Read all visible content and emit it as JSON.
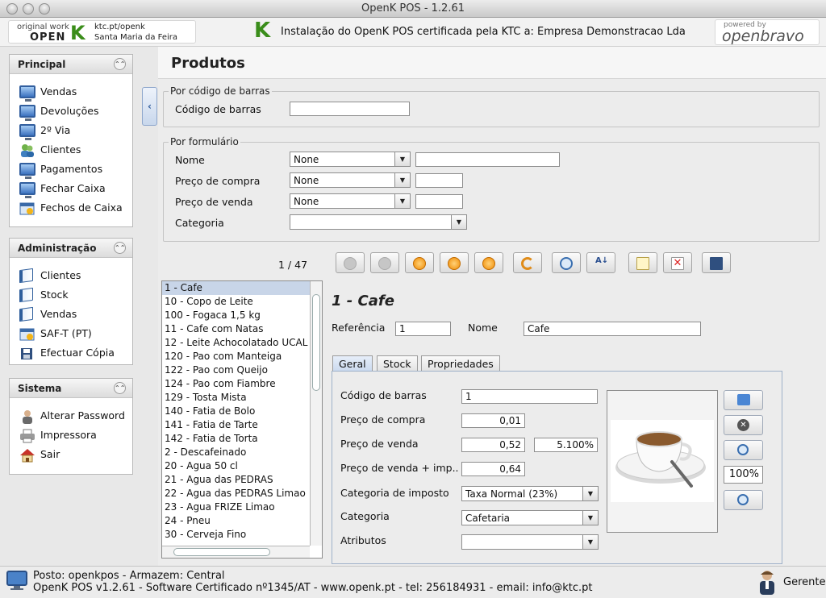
{
  "window": {
    "title": "OpenK POS - 1.2.61"
  },
  "header": {
    "logo_original_work": "original work",
    "logo_brand": "OPEN",
    "logo_k": "K",
    "logo_url": "ktc.pt/openk",
    "logo_city": "Santa Maria da Feira",
    "installation_text": "Instalação do OpenK POS certificada pela KTC a: Empresa Demonstracao Lda",
    "powered_by": "powered by",
    "openbravo": "openbravo"
  },
  "sidebar": {
    "principal": {
      "title": "Principal",
      "items": [
        {
          "label": "Vendas",
          "icon": "monitor-icon"
        },
        {
          "label": "Devoluções",
          "icon": "monitor-icon"
        },
        {
          "label": "2º Via",
          "icon": "monitor-icon"
        },
        {
          "label": "Clientes",
          "icon": "users-icon"
        },
        {
          "label": "Pagamentos",
          "icon": "monitor-icon"
        },
        {
          "label": "Fechar Caixa",
          "icon": "monitor-icon"
        },
        {
          "label": "Fechos de Caixa",
          "icon": "calendar-icon"
        }
      ]
    },
    "administracao": {
      "title": "Administração",
      "items": [
        {
          "label": "Clientes",
          "icon": "book-icon"
        },
        {
          "label": "Stock",
          "icon": "book-icon"
        },
        {
          "label": "Vendas",
          "icon": "book-icon"
        },
        {
          "label": "SAF-T (PT)",
          "icon": "calendar-icon"
        },
        {
          "label": "Efectuar Cópia",
          "icon": "floppy-icon"
        }
      ]
    },
    "sistema": {
      "title": "Sistema",
      "items": [
        {
          "label": "Alterar Password",
          "icon": "user-icon"
        },
        {
          "label": "Impressora",
          "icon": "printer-icon"
        },
        {
          "label": "Sair",
          "icon": "home-icon"
        }
      ]
    }
  },
  "page": {
    "title": "Produtos"
  },
  "barcode_search": {
    "legend": "Por código de barras",
    "label": "Código de barras",
    "value": ""
  },
  "form_search": {
    "legend": "Por formulário",
    "nome": {
      "label": "Nome",
      "operator": "None",
      "value": ""
    },
    "preco_compra": {
      "label": "Preço de compra",
      "operator": "None",
      "value": ""
    },
    "preco_venda": {
      "label": "Preço de venda",
      "operator": "None",
      "value": ""
    },
    "categoria": {
      "label": "Categoria",
      "value": ""
    }
  },
  "toolbar": {
    "pager": "1 / 47"
  },
  "products": [
    "1 - Cafe",
    "10 - Copo de Leite",
    "100 - Fogaca 1,5 kg",
    "11 - Cafe com Natas",
    "12 - Leite Achocolatado UCAL",
    "120 - Pao com Manteiga",
    "122 - Pao com Queijo",
    "124 - Pao com Fiambre",
    "129 - Tosta Mista",
    "140 - Fatia de Bolo",
    "141 - Fatia de Tarte",
    "142 - Fatia de Torta",
    "2 - Descafeinado",
    "20 - Agua 50 cl",
    "21 - Agua das PEDRAS",
    "22 - Agua das PEDRAS Limao",
    "23 - Agua FRIZE Limao",
    "24 - Pneu",
    "30 - Cerveja Fino"
  ],
  "detail": {
    "title": "1 -  Cafe",
    "referencia_label": "Referência",
    "referencia": "1",
    "nome_label": "Nome",
    "nome": "Cafe",
    "tabs": [
      "Geral",
      "Stock",
      "Propriedades"
    ],
    "codigo_barras_label": "Código de barras",
    "codigo_barras": "1",
    "preco_compra_label": "Preço de compra",
    "preco_compra": "0,01",
    "preco_venda_label": "Preço de venda",
    "preco_venda": "0,52",
    "margem": "5.100%",
    "preco_venda_imp_label": "Preço de venda + imp...",
    "preco_venda_imp": "0,64",
    "categoria_imposto_label": "Categoria de imposto",
    "categoria_imposto": "Taxa Normal (23%)",
    "categoria_label": "Categoria",
    "categoria": "Cafetaria",
    "atributos_label": "Atributos",
    "atributos": "",
    "zoom": "100%"
  },
  "footer": {
    "line1": "Posto: openkpos - Armazem: Central",
    "line2": "OpenK POS v1.2.61 - Software Certificado nº1345/AT - www.openk.pt - tel: 256184931 - email: info@ktc.pt",
    "user": "Gerente"
  }
}
